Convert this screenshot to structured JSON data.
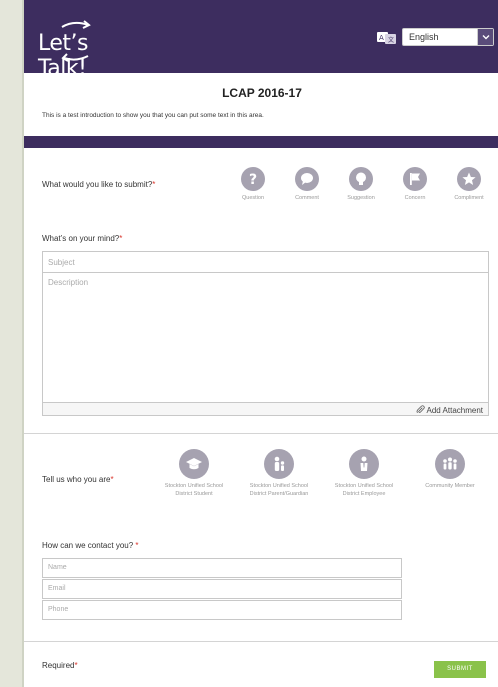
{
  "header": {
    "logo_text": "Let’s Talk!",
    "language": {
      "selected": "English",
      "icon": "translate-icon"
    }
  },
  "form": {
    "title": "LCAP 2016-17",
    "intro": "This is a test introduction to show you that you can put some text in this area."
  },
  "submit_type": {
    "label": "What would you like to submit?",
    "required_mark": "*",
    "options": [
      {
        "label": "Question",
        "icon": "question-icon"
      },
      {
        "label": "Comment",
        "icon": "comment-icon"
      },
      {
        "label": "Suggestion",
        "icon": "lightbulb-icon"
      },
      {
        "label": "Concern",
        "icon": "flag-icon"
      },
      {
        "label": "Compliment",
        "icon": "star-icon"
      }
    ]
  },
  "mind": {
    "label": "What’s on your mind?",
    "required_mark": "*",
    "subject_placeholder": "Subject",
    "description_placeholder": "Description",
    "attachment_label": "Add Attachment"
  },
  "who": {
    "label": "Tell us who you are",
    "required_mark": "*",
    "options": [
      {
        "label_line1": "Stockton Unified School",
        "label_line2": "District Student",
        "icon": "graduation-cap-icon"
      },
      {
        "label_line1": "Stockton Unified School",
        "label_line2": "District Parent/Guardian",
        "icon": "parent-icon"
      },
      {
        "label_line1": "Stockton Unified School",
        "label_line2": "District Employee",
        "icon": "employee-icon"
      },
      {
        "label_line1": "Community Member",
        "label_line2": "",
        "icon": "community-icon"
      }
    ]
  },
  "contact": {
    "label": "How can we contact you?",
    "required_mark": "*",
    "name_placeholder": "Name",
    "email_placeholder": "Email",
    "phone_placeholder": "Phone"
  },
  "footer": {
    "required_label": "Required",
    "required_mark": "*",
    "submit_label": "SUBMIT"
  },
  "colors": {
    "header": "#3d2d5f",
    "submit": "#8ac24a",
    "required": "#d9342b",
    "option_circle": "#a6a2b0"
  }
}
